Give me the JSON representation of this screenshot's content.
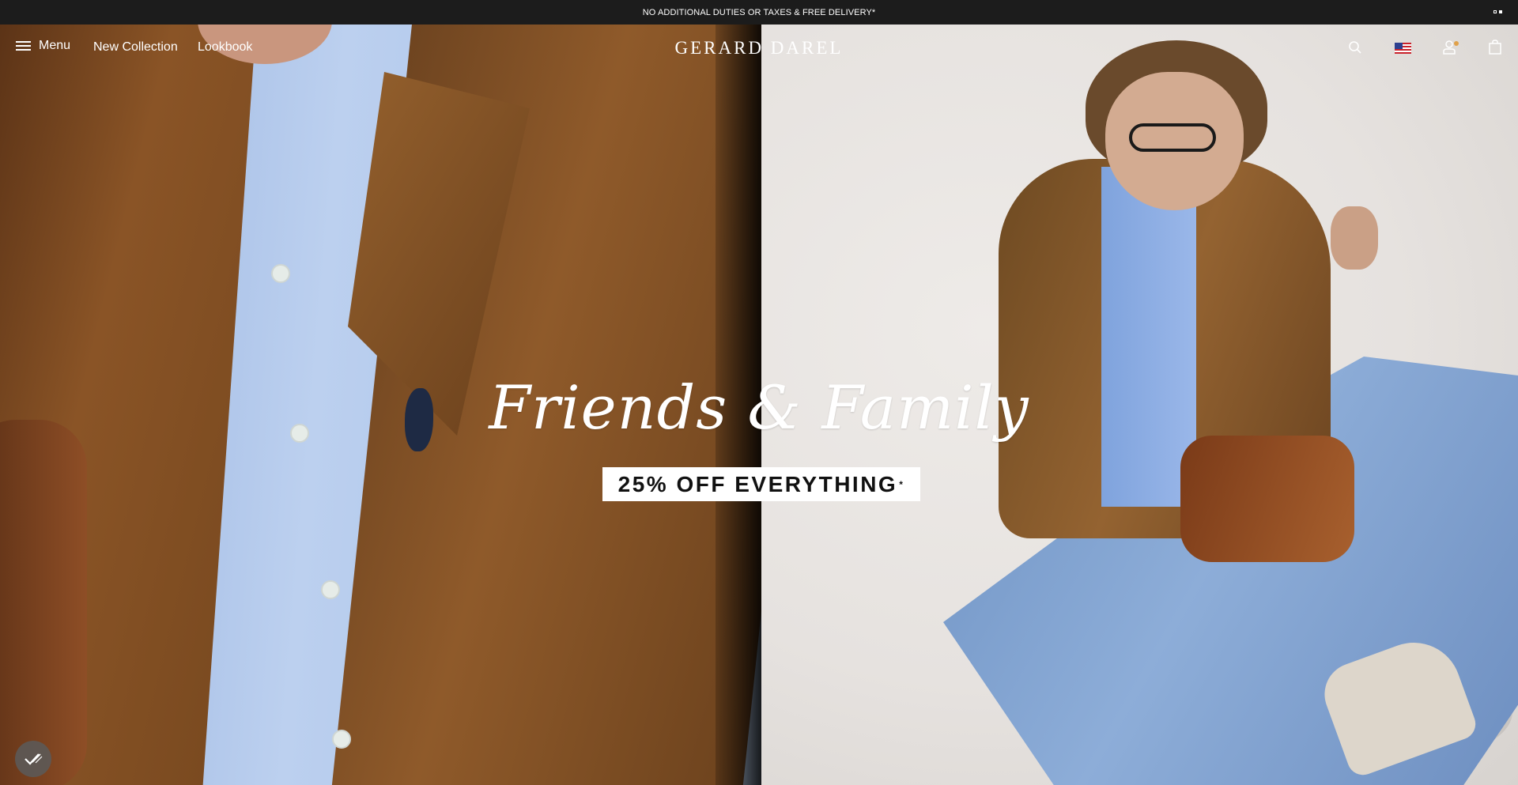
{
  "announcement": {
    "text": "NO ADDITIONAL DUTIES OR TAXES & FREE DELIVERY*",
    "slides_total": 2,
    "active_slide": 2
  },
  "header": {
    "menu_label": "Menu",
    "nav_links": [
      "New Collection",
      "Lookbook"
    ],
    "logo_text": "GERARD DAREL",
    "icons": [
      "search-icon",
      "us-flag-icon",
      "account-icon",
      "cart-icon"
    ]
  },
  "hero": {
    "title": "Friends & Family",
    "cta_text": "25% OFF EVERYTHING",
    "cta_mark": "*"
  },
  "colors": {
    "topbar_bg": "#1c1c1c",
    "text_light": "#ffffff",
    "notification_dot": "#e0a14a"
  }
}
